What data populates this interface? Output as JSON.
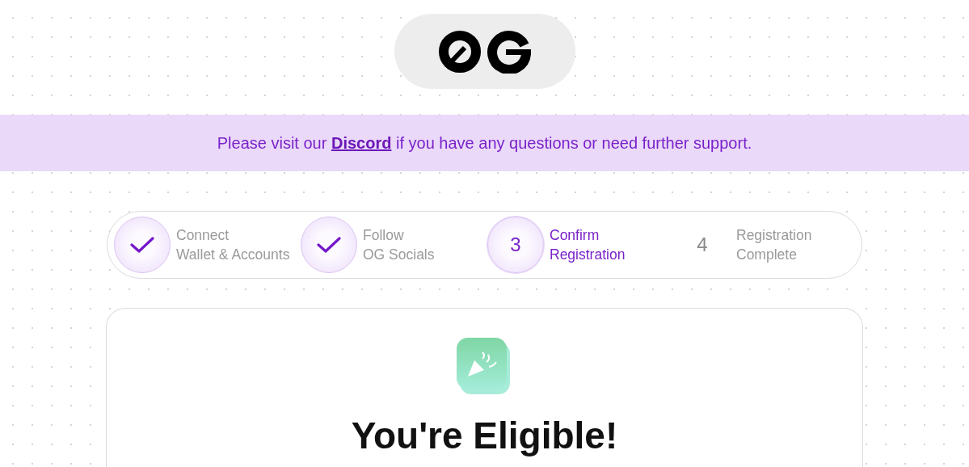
{
  "banner": {
    "before": "Please visit our",
    "link": "Discord",
    "after": "if you have any questions or need further support."
  },
  "steps": [
    {
      "completed": true,
      "selected": false,
      "line1": "Connect",
      "line2": "Wallet & Accounts"
    },
    {
      "completed": true,
      "selected": false,
      "line1": "Follow",
      "line2": "OG Socials"
    },
    {
      "completed": false,
      "selected": true,
      "number": "3",
      "line1": "Confirm",
      "line2": "Registration"
    },
    {
      "completed": false,
      "selected": false,
      "number": "4",
      "line1": "Registration",
      "line2": "Complete"
    }
  ],
  "card": {
    "title": "You're Eligible!"
  }
}
